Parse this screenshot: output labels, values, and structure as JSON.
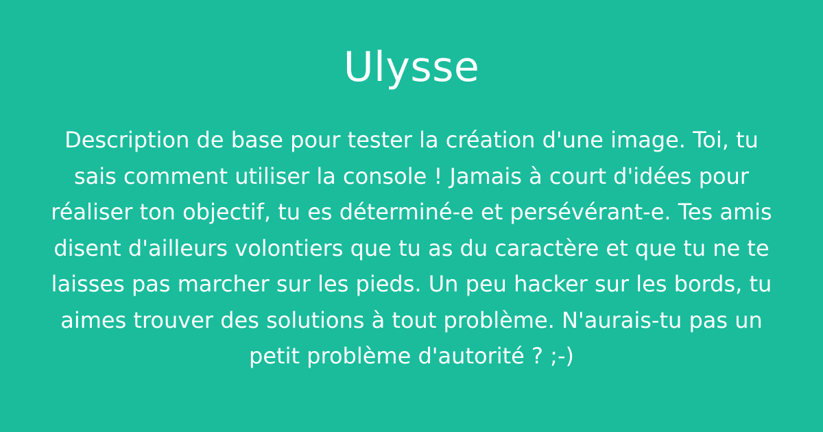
{
  "card": {
    "title": "Ulysse",
    "description": "Description de base pour tester la création d'une image. Toi, tu sais comment utiliser la console ! Jamais à court d'idées pour réaliser ton objectif, tu es déterminé-e et persévérant-e. Tes amis disent d'ailleurs volontiers que tu as du caractère et que tu ne te laisses pas marcher sur les pieds. Un peu hacker sur les bords, tu aimes trouver des solutions à tout problème. N'aurais-tu pas un petit problème d'autorité ? ;-)"
  },
  "colors": {
    "background": "#1abc9c",
    "text": "#ffffff"
  }
}
